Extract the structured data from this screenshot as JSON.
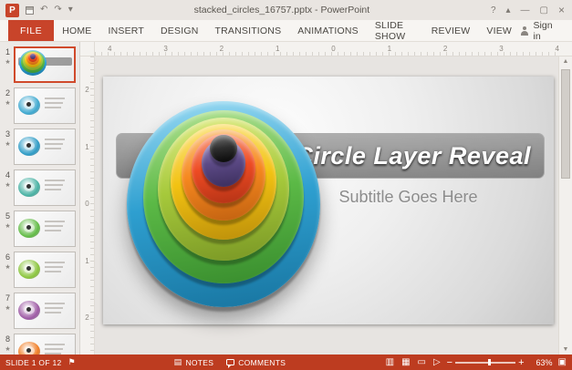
{
  "colors": {
    "accent": "#C8442A",
    "status_bar": "#BD3C20"
  },
  "title_bar": {
    "title": "stacked_circles_16757.pptx - PowerPoint"
  },
  "ribbon": {
    "file_tab": "FILE",
    "tabs": [
      "HOME",
      "INSERT",
      "DESIGN",
      "TRANSITIONS",
      "ANIMATIONS",
      "SLIDE SHOW",
      "REVIEW",
      "VIEW"
    ],
    "sign_in": "Sign in"
  },
  "rulers": {
    "horizontal": [
      "4",
      "3",
      "2",
      "1",
      "0",
      "1",
      "2",
      "3",
      "4"
    ],
    "vertical": [
      "2",
      "1",
      "0",
      "1",
      "2"
    ]
  },
  "thumbnail_panel": {
    "slides": [
      {
        "number": "1",
        "selected": true
      },
      {
        "number": "2",
        "color": "#3FA9D0"
      },
      {
        "number": "3",
        "color": "#2F9CC6"
      },
      {
        "number": "4",
        "color": "#49B2A4"
      },
      {
        "number": "5",
        "color": "#63BC47"
      },
      {
        "number": "6",
        "color": "#8CC63F"
      },
      {
        "number": "7",
        "color": "#9E5BA5"
      },
      {
        "number": "8",
        "color": "#F07E26"
      }
    ]
  },
  "slide": {
    "title": "Circle Layer Reveal",
    "subtitle": "Subtitle Goes Here",
    "circles": [
      {
        "name": "blue",
        "light": "#8ED4EF",
        "base": "#2E9FD0",
        "dark": "#1A79A5"
      },
      {
        "name": "green",
        "light": "#A8DD8A",
        "base": "#5BB946",
        "dark": "#3C9130"
      },
      {
        "name": "yellow-green",
        "light": "#D9E87E",
        "base": "#A6C93B",
        "dark": "#7E9C27"
      },
      {
        "name": "yellow",
        "light": "#FBE27A",
        "base": "#F2C212",
        "dark": "#C1940B"
      },
      {
        "name": "orange",
        "light": "#FBC07A",
        "base": "#F6881F",
        "dark": "#C66512"
      },
      {
        "name": "red-orange",
        "light": "#F89A7C",
        "base": "#EE4B23",
        "dark": "#B93517"
      },
      {
        "name": "purple",
        "light": "#9B8BBF",
        "base": "#5C4A86",
        "dark": "#3E3060"
      },
      {
        "name": "black-knob",
        "light": "#6E6E6E",
        "base": "#2E2E2E",
        "dark": "#0A0A0A"
      }
    ]
  },
  "status_bar": {
    "slide_indicator": "SLIDE 1 OF 12",
    "notes_label": "NOTES",
    "comments_label": "COMMENTS",
    "zoom_level": "63%"
  },
  "icons": {
    "app_glyph": "P",
    "undo": "↶",
    "redo": "↷",
    "qat_dropdown": "▾",
    "help": "?",
    "ribbon_options": "▴",
    "minimize": "—",
    "restore": "▢",
    "close": "×",
    "animation_star": "★",
    "flag": "⚑",
    "notes": "▤",
    "view_normal": "▥",
    "view_sorter": "▦",
    "view_reading": "▭",
    "view_slideshow": "▷",
    "zoom_out": "−",
    "zoom_in": "+",
    "fit": "▣",
    "scroll_up": "▲",
    "scroll_down": "▼"
  }
}
